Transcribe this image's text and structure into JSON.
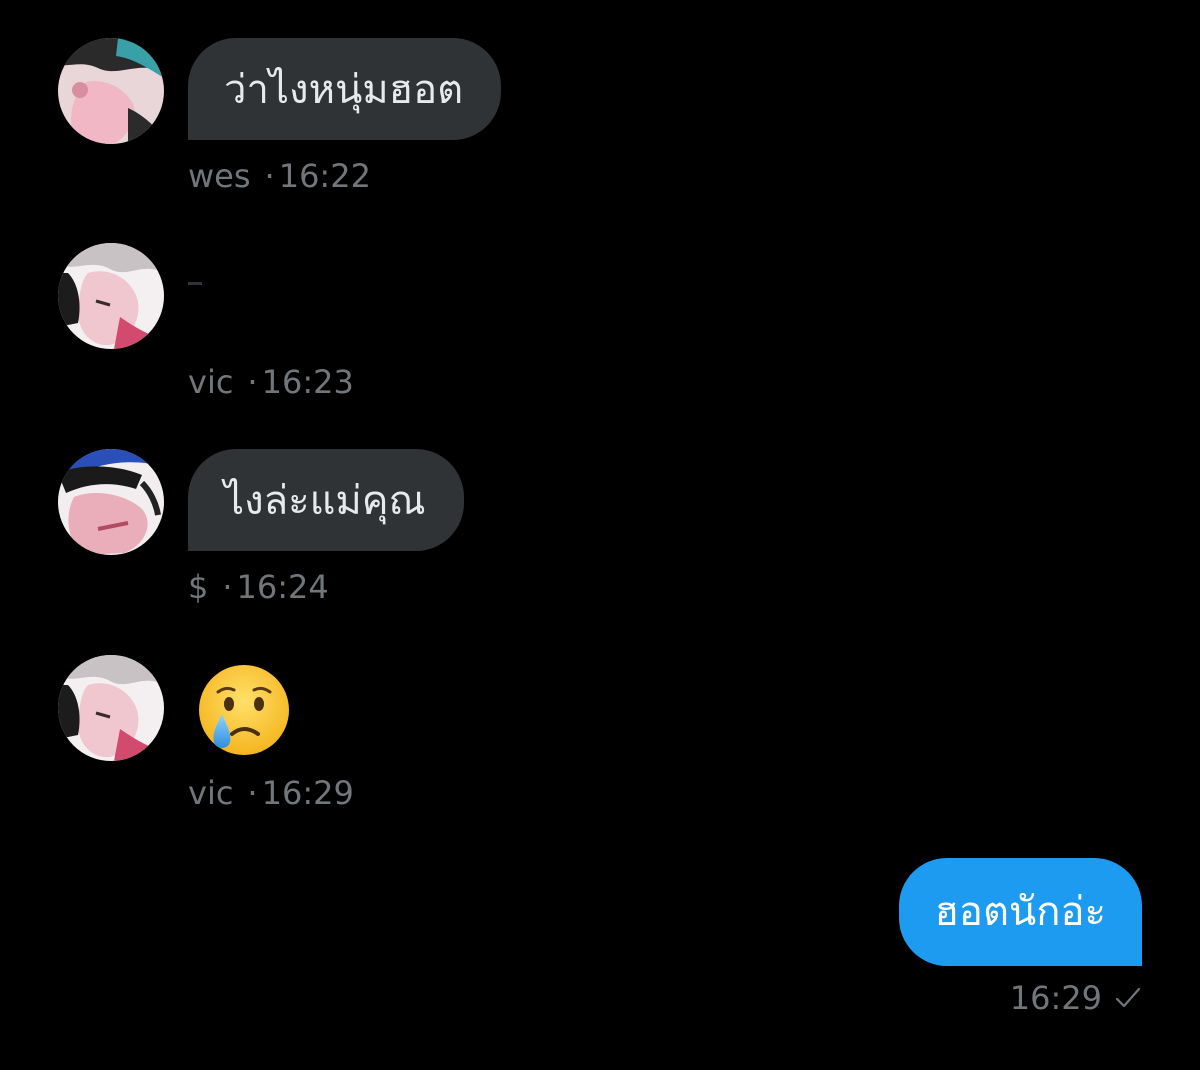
{
  "messages": [
    {
      "sender": "wes",
      "time": "16:22",
      "text": "ว่าไงหนุ่มฮอต",
      "avatar_icon": "avatar-wes"
    },
    {
      "sender": "vic",
      "time": "16:23",
      "text": "",
      "avatar_icon": "avatar-vic"
    },
    {
      "sender": "$",
      "time": "16:24",
      "text": "ไงล่ะแม่คุณ",
      "avatar_icon": "avatar-dollar"
    },
    {
      "sender": "vic",
      "time": "16:29",
      "emoji": "crying-face-emoji",
      "avatar_icon": "avatar-vic"
    }
  ],
  "outgoing": {
    "text": "ฮอตนักอ่ะ",
    "time": "16:29",
    "status_icon": "checkmark-icon"
  },
  "separator": "·",
  "colors": {
    "background": "#000000",
    "incoming_bubble": "#2f3336",
    "outgoing_bubble": "#1d9bf0",
    "meta_text": "#71767b"
  }
}
